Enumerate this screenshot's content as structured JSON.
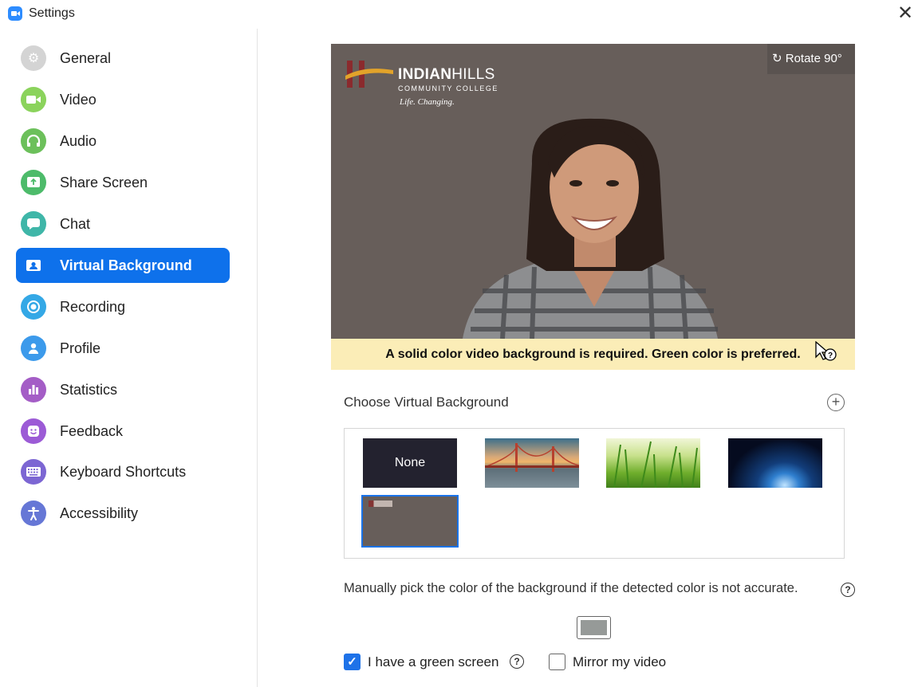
{
  "window": {
    "title": "Settings",
    "close_icon": "close-icon"
  },
  "sidebar": {
    "items": [
      {
        "label": "General",
        "icon": "gear-icon",
        "color": "#cfcfcf",
        "active": false
      },
      {
        "label": "Video",
        "icon": "video-camera-icon",
        "color": "#8bd35c",
        "active": false
      },
      {
        "label": "Audio",
        "icon": "headphones-icon",
        "color": "#6cc05b",
        "active": false
      },
      {
        "label": "Share Screen",
        "icon": "share-screen-icon",
        "color": "#4dbb6a",
        "active": false
      },
      {
        "label": "Chat",
        "icon": "chat-bubble-icon",
        "color": "#3fb6a8",
        "active": false
      },
      {
        "label": "Virtual Background",
        "icon": "person-card-icon",
        "color": "#0e71eb",
        "active": true
      },
      {
        "label": "Recording",
        "icon": "record-icon",
        "color": "#34a8e6",
        "active": false
      },
      {
        "label": "Profile",
        "icon": "person-icon",
        "color": "#3c9aeb",
        "active": false
      },
      {
        "label": "Statistics",
        "icon": "bar-chart-icon",
        "color": "#a45dc6",
        "active": false
      },
      {
        "label": "Feedback",
        "icon": "smile-icon",
        "color": "#9c5bd6",
        "active": false
      },
      {
        "label": "Keyboard Shortcuts",
        "icon": "keyboard-icon",
        "color": "#7c66d3",
        "active": false
      },
      {
        "label": "Accessibility",
        "icon": "accessibility-icon",
        "color": "#6677d6",
        "active": false
      }
    ]
  },
  "preview": {
    "rotate_label": "Rotate 90°",
    "logo_name_bold": "INDIAN",
    "logo_name_light": "HILLS",
    "logo_sub": "COMMUNITY COLLEGE",
    "logo_tag": "Life. Changing.",
    "notice": "A solid color video background is required. Green color is preferred."
  },
  "backgrounds": {
    "section_title": "Choose Virtual Background",
    "add_icon": "plus-circle-icon",
    "items": [
      {
        "label": "None",
        "kind": "none"
      },
      {
        "label": "",
        "kind": "golden-gate-bridge"
      },
      {
        "label": "",
        "kind": "grass"
      },
      {
        "label": "",
        "kind": "earth-from-space"
      },
      {
        "label": "",
        "kind": "custom-indian-hills",
        "selected": true
      }
    ]
  },
  "color_pick": {
    "hint": "Manually pick the color of the background if the detected color is not accurate.",
    "swatch_color": "#969a98"
  },
  "options": {
    "green_screen_label": "I have a green screen",
    "green_screen_checked": true,
    "mirror_label": "Mirror my video",
    "mirror_checked": false
  }
}
